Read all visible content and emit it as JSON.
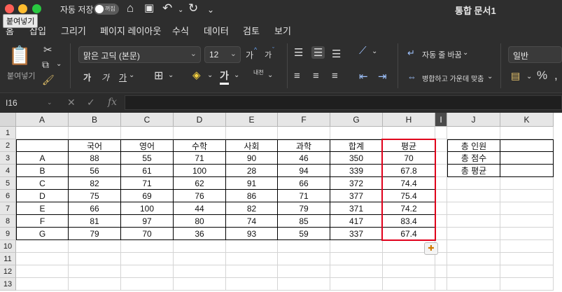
{
  "titlebar": {
    "autosave_label": "자동 저장",
    "toggle_label": "꺼짐",
    "doc_title": "통합 문서1"
  },
  "tooltip": "붙여넣기",
  "tabs": [
    "홈",
    "삽입",
    "그리기",
    "페이지 레이아웃",
    "수식",
    "데이터",
    "검토",
    "보기"
  ],
  "ribbon": {
    "paste_label": "붙여넣기",
    "font_name": "맑은 고딕 (본문)",
    "font_size": "12",
    "grow_font": "가",
    "shrink_font": "가",
    "bold": "가",
    "italic": "가",
    "underline": "가",
    "font_color": "가",
    "phonetic": "내천",
    "wrap_text": "자동 줄 바꿈",
    "merge_center": "병합하고 가운데 맞춤",
    "number_format": "일반",
    "percent": "%"
  },
  "formula_bar": {
    "name_box": "I16",
    "fx": "fx",
    "value": ""
  },
  "grid": {
    "columns": [
      "A",
      "B",
      "C",
      "D",
      "E",
      "F",
      "G",
      "H",
      "I",
      "J",
      "K"
    ],
    "rows": [
      "1",
      "2",
      "3",
      "4",
      "5",
      "6",
      "7",
      "8",
      "9",
      "10",
      "11",
      "12",
      "13"
    ],
    "headers": [
      "국어",
      "영어",
      "수학",
      "사회",
      "과학",
      "합계",
      "평균"
    ],
    "data": [
      [
        "A",
        "88",
        "55",
        "71",
        "90",
        "46",
        "350",
        "70"
      ],
      [
        "B",
        "56",
        "61",
        "100",
        "28",
        "94",
        "339",
        "67.8"
      ],
      [
        "C",
        "82",
        "71",
        "62",
        "91",
        "66",
        "372",
        "74.4"
      ],
      [
        "D",
        "75",
        "69",
        "76",
        "86",
        "71",
        "377",
        "75.4"
      ],
      [
        "E",
        "66",
        "100",
        "44",
        "82",
        "79",
        "371",
        "74.2"
      ],
      [
        "F",
        "81",
        "97",
        "80",
        "74",
        "85",
        "417",
        "83.4"
      ],
      [
        "G",
        "79",
        "70",
        "36",
        "93",
        "59",
        "337",
        "67.4"
      ]
    ],
    "summary_labels": [
      "총 인원",
      "총 점수",
      "총 평균"
    ]
  },
  "colors": {
    "accent_red": "#e0001b",
    "ribbon_bg": "#2e2e2e",
    "grid_bg": "#ffffff"
  }
}
